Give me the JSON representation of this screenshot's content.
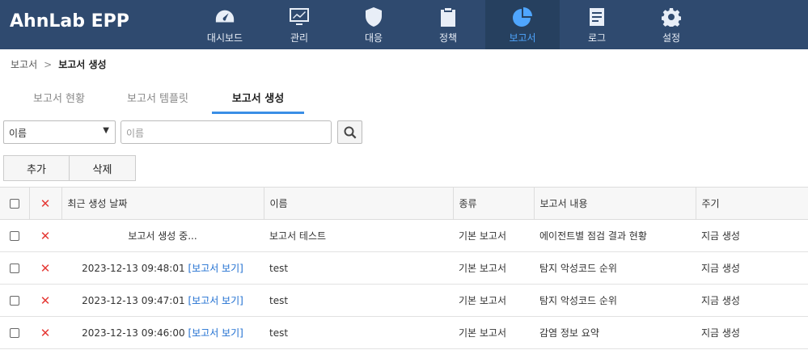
{
  "app": {
    "title": "AhnLab EPP"
  },
  "nav": [
    {
      "label": "대시보드",
      "icon": "gauge-icon"
    },
    {
      "label": "관리",
      "icon": "monitor-chart-icon"
    },
    {
      "label": "대응",
      "icon": "shield-icon"
    },
    {
      "label": "정책",
      "icon": "clipboard-icon"
    },
    {
      "label": "보고서",
      "icon": "pie-chart-icon",
      "active": true
    },
    {
      "label": "로그",
      "icon": "document-icon"
    },
    {
      "label": "설정",
      "icon": "gear-icon"
    }
  ],
  "breadcrumb": {
    "parent": "보고서",
    "current": "보고서 생성"
  },
  "tabs": [
    {
      "label": "보고서 현황"
    },
    {
      "label": "보고서 템플릿"
    },
    {
      "label": "보고서 생성",
      "active": true
    }
  ],
  "search": {
    "field_select": "이름",
    "placeholder": "이름"
  },
  "actions": {
    "add": "추가",
    "delete": "삭제"
  },
  "table": {
    "headers": {
      "date": "최근 생성 날짜",
      "name": "이름",
      "kind": "종류",
      "content": "보고서 내용",
      "cycle": "주기"
    },
    "rows": [
      {
        "date": "보고서 생성 중...",
        "view": "",
        "name": "보고서 테스트",
        "kind": "기본 보고서",
        "content": "에이전트별 점검 결과 현황",
        "cycle": "지금 생성"
      },
      {
        "date": "2023-12-13 09:48:01",
        "view": "[보고서 보기]",
        "name": "test",
        "kind": "기본 보고서",
        "content": "탐지 악성코드 순위",
        "cycle": "지금 생성"
      },
      {
        "date": "2023-12-13 09:47:01",
        "view": "[보고서 보기]",
        "name": "test",
        "kind": "기본 보고서",
        "content": "탐지 악성코드 순위",
        "cycle": "지금 생성"
      },
      {
        "date": "2023-12-13 09:46:00",
        "view": "[보고서 보기]",
        "name": "test",
        "kind": "기본 보고서",
        "content": "감염 정보 요약",
        "cycle": "지금 생성"
      }
    ]
  },
  "colors": {
    "topbar": "#2f4a6f",
    "active_nav": "#4fa6ff",
    "delete_x": "#e53935",
    "link": "#1f6fd1"
  }
}
